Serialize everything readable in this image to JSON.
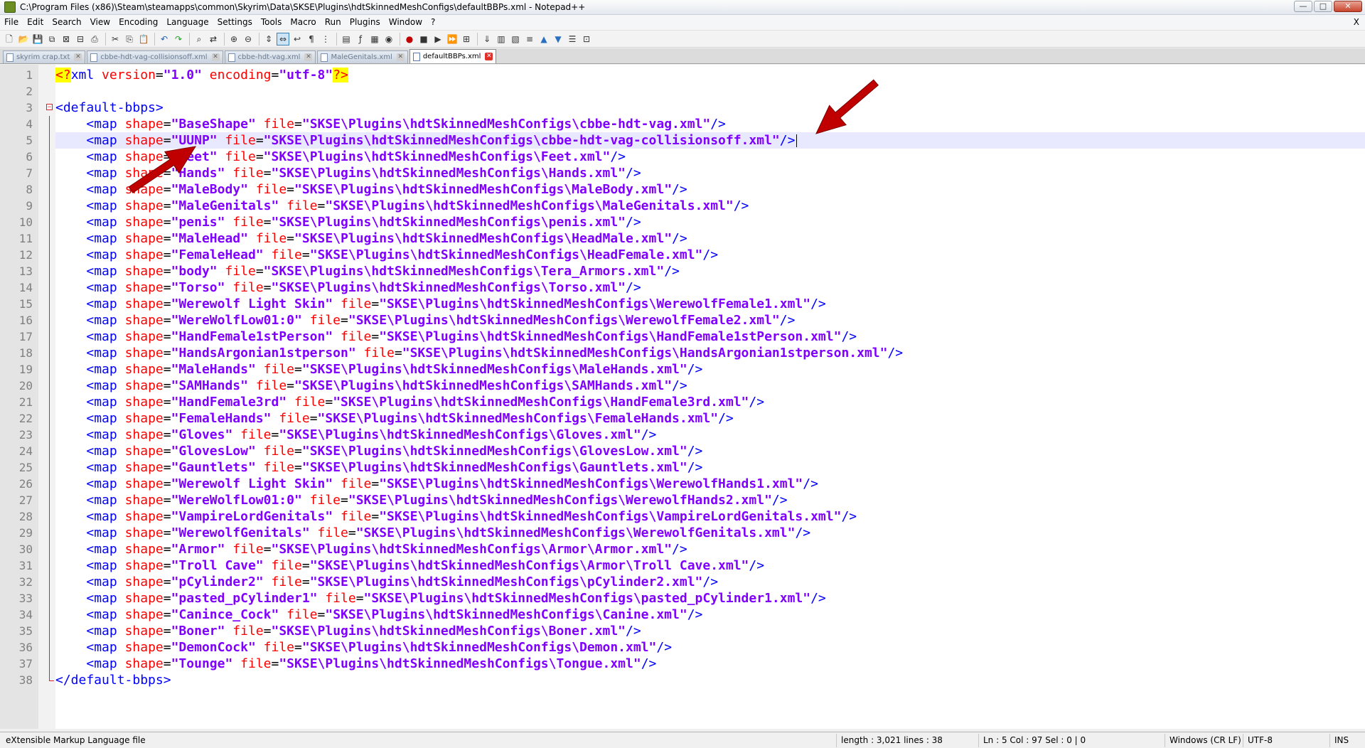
{
  "window": {
    "title": "C:\\Program Files (x86)\\Steam\\steamapps\\common\\Skyrim\\Data\\SKSE\\Plugins\\hdtSkinnedMeshConfigs\\defaultBBPs.xml - Notepad++",
    "icon": "notepad-plus-plus-icon",
    "controls": [
      "minimize-icon",
      "maximize-icon",
      "close-icon"
    ]
  },
  "menu": {
    "items": [
      "File",
      "Edit",
      "Search",
      "View",
      "Encoding",
      "Language",
      "Settings",
      "Tools",
      "Macro",
      "Run",
      "Plugins",
      "Window",
      "?"
    ],
    "close_glyph": "X"
  },
  "toolbar": {
    "icons": [
      "new-file-icon",
      "open-file-icon",
      "save-icon",
      "save-all-icon",
      "close-icon",
      "close-all-icon",
      "print-icon",
      "|",
      "cut-icon",
      "copy-icon",
      "paste-icon",
      "|",
      "undo-icon",
      "redo-icon",
      "|",
      "find-icon",
      "replace-icon",
      "|",
      "zoom-in-icon",
      "zoom-out-icon",
      "|",
      "sync-vertical-icon",
      "sync-horizontal-icon",
      "word-wrap-icon",
      "show-all-chars-icon",
      "indent-guide-icon",
      "|",
      "document-map-icon",
      "function-list-icon",
      "folder-workspace-icon",
      "monitor-icon",
      "|",
      "record-macro-icon",
      "stop-record-icon",
      "play-macro-icon",
      "run-macro-multiple-icon",
      "save-macro-icon",
      "|",
      "plugin-a-icon",
      "plugin-b-icon",
      "plugin-c-icon",
      "plugin-d-icon",
      "plugin-e-icon",
      "plugin-f-icon",
      "plugin-g-icon",
      "plugin-h-icon"
    ],
    "active_index": 22
  },
  "tabs": [
    {
      "label": "skyrim crap.txt",
      "active": false
    },
    {
      "label": "cbbe-hdt-vag-collisionsoff.xml",
      "active": false
    },
    {
      "label": "cbbe-hdt-vag.xml",
      "active": false
    },
    {
      "label": "MaleGenitals.xml",
      "active": false
    },
    {
      "label": "defaultBBPs.xml",
      "active": true
    }
  ],
  "editor": {
    "current_line": 5,
    "colors": {
      "tag": "#0000ff",
      "attr": "#ff0000",
      "value": "#8000ff",
      "pi_bg": "#ffff00",
      "current_line": "#e8e8ff"
    },
    "lines": [
      {
        "n": "1",
        "tokens": [
          [
            "pi",
            "<?"
          ],
          [
            "tag",
            "xml"
          ],
          [
            "plain",
            " "
          ],
          [
            "attr",
            "version"
          ],
          [
            "eq",
            "="
          ],
          [
            "val",
            "\"1.0\""
          ],
          [
            "plain",
            " "
          ],
          [
            "attr",
            "encoding"
          ],
          [
            "eq",
            "="
          ],
          [
            "val",
            "\"utf-8\""
          ],
          [
            "pi",
            "?>"
          ]
        ]
      },
      {
        "n": "2",
        "tokens": []
      },
      {
        "n": "3",
        "tokens": [
          [
            "tag",
            "<default-bbps>"
          ]
        ]
      },
      {
        "n": "4",
        "shape": "BaseShape",
        "file": "SKSE\\Plugins\\hdtSkinnedMeshConfigs\\cbbe-hdt-vag.xml"
      },
      {
        "n": "5",
        "shape": "UUNP",
        "file": "SKSE\\Plugins\\hdtSkinnedMeshConfigs\\cbbe-hdt-vag-collisionsoff.xml"
      },
      {
        "n": "6",
        "shape": "Feet",
        "file": "SKSE\\Plugins\\hdtSkinnedMeshConfigs\\Feet.xml"
      },
      {
        "n": "7",
        "shape": "Hands",
        "file": "SKSE\\Plugins\\hdtSkinnedMeshConfigs\\Hands.xml"
      },
      {
        "n": "8",
        "shape": "MaleBody",
        "file": "SKSE\\Plugins\\hdtSkinnedMeshConfigs\\MaleBody.xml"
      },
      {
        "n": "9",
        "shape": "MaleGenitals",
        "file": "SKSE\\Plugins\\hdtSkinnedMeshConfigs\\MaleGenitals.xml"
      },
      {
        "n": "10",
        "shape": "penis",
        "file": "SKSE\\Plugins\\hdtSkinnedMeshConfigs\\penis.xml"
      },
      {
        "n": "11",
        "shape": "MaleHead",
        "file": "SKSE\\Plugins\\hdtSkinnedMeshConfigs\\HeadMale.xml"
      },
      {
        "n": "12",
        "shape": "FemaleHead",
        "file": "SKSE\\Plugins\\hdtSkinnedMeshConfigs\\HeadFemale.xml"
      },
      {
        "n": "13",
        "shape": "body",
        "file": "SKSE\\Plugins\\hdtSkinnedMeshConfigs\\Tera_Armors.xml"
      },
      {
        "n": "14",
        "shape": "Torso",
        "file": "SKSE\\Plugins\\hdtSkinnedMeshConfigs\\Torso.xml"
      },
      {
        "n": "15",
        "shape": "Werewolf Light Skin",
        "file": "SKSE\\Plugins\\hdtSkinnedMeshConfigs\\WerewolfFemale1.xml"
      },
      {
        "n": "16",
        "shape": "WereWolfLow01:0",
        "file": "SKSE\\Plugins\\hdtSkinnedMeshConfigs\\WerewolfFemale2.xml"
      },
      {
        "n": "17",
        "shape": "HandFemale1stPerson",
        "file": "SKSE\\Plugins\\hdtSkinnedMeshConfigs\\HandFemale1stPerson.xml"
      },
      {
        "n": "18",
        "shape": "HandsArgonian1stperson",
        "file": "SKSE\\Plugins\\hdtSkinnedMeshConfigs\\HandsArgonian1stperson.xml"
      },
      {
        "n": "19",
        "shape": "MaleHands",
        "file": "SKSE\\Plugins\\hdtSkinnedMeshConfigs\\MaleHands.xml"
      },
      {
        "n": "20",
        "shape": "SAMHands",
        "file": "SKSE\\Plugins\\hdtSkinnedMeshConfigs\\SAMHands.xml"
      },
      {
        "n": "21",
        "shape": "HandFemale3rd",
        "file": "SKSE\\Plugins\\hdtSkinnedMeshConfigs\\HandFemale3rd.xml"
      },
      {
        "n": "22",
        "shape": "FemaleHands",
        "file": "SKSE\\Plugins\\hdtSkinnedMeshConfigs\\FemaleHands.xml"
      },
      {
        "n": "23",
        "shape": "Gloves",
        "file": "SKSE\\Plugins\\hdtSkinnedMeshConfigs\\Gloves.xml"
      },
      {
        "n": "24",
        "shape": "GlovesLow",
        "file": "SKSE\\Plugins\\hdtSkinnedMeshConfigs\\GlovesLow.xml"
      },
      {
        "n": "25",
        "shape": "Gauntlets",
        "file": "SKSE\\Plugins\\hdtSkinnedMeshConfigs\\Gauntlets.xml"
      },
      {
        "n": "26",
        "shape": "Werewolf Light Skin",
        "file": "SKSE\\Plugins\\hdtSkinnedMeshConfigs\\WerewolfHands1.xml"
      },
      {
        "n": "27",
        "shape": "WereWolfLow01:0",
        "file": "SKSE\\Plugins\\hdtSkinnedMeshConfigs\\WerewolfHands2.xml"
      },
      {
        "n": "28",
        "shape": "VampireLordGenitals",
        "file": "SKSE\\Plugins\\hdtSkinnedMeshConfigs\\VampireLordGenitals.xml"
      },
      {
        "n": "29",
        "shape": "WerewolfGenitals",
        "file": "SKSE\\Plugins\\hdtSkinnedMeshConfigs\\WerewolfGenitals.xml"
      },
      {
        "n": "30",
        "shape": "Armor",
        "file": "SKSE\\Plugins\\hdtSkinnedMeshConfigs\\Armor\\Armor.xml"
      },
      {
        "n": "31",
        "shape": "Troll Cave",
        "file": "SKSE\\Plugins\\hdtSkinnedMeshConfigs\\Armor\\Troll Cave.xml"
      },
      {
        "n": "32",
        "shape": "pCylinder2",
        "file": "SKSE\\Plugins\\hdtSkinnedMeshConfigs\\pCylinder2.xml"
      },
      {
        "n": "33",
        "shape": "pasted_pCylinder1",
        "file": "SKSE\\Plugins\\hdtSkinnedMeshConfigs\\pasted_pCylinder1.xml"
      },
      {
        "n": "34",
        "shape": "Canince_Cock",
        "file": "SKSE\\Plugins\\hdtSkinnedMeshConfigs\\Canine.xml"
      },
      {
        "n": "35",
        "shape": "Boner",
        "file": "SKSE\\Plugins\\hdtSkinnedMeshConfigs\\Boner.xml"
      },
      {
        "n": "36",
        "shape": "DemonCock",
        "file": "SKSE\\Plugins\\hdtSkinnedMeshConfigs\\Demon.xml"
      },
      {
        "n": "37",
        "shape": "Tounge",
        "file": "SKSE\\Plugins\\hdtSkinnedMeshConfigs\\Tongue.xml"
      },
      {
        "n": "38",
        "tokens": [
          [
            "tag",
            "</default-bbps>"
          ]
        ]
      }
    ]
  },
  "status": {
    "file_type": "eXtensible Markup Language file",
    "length_lines": "length : 3,021    lines : 38",
    "position": "Ln : 5    Col : 97    Sel : 0 | 0",
    "eol": "Windows (CR LF)",
    "encoding": "UTF-8",
    "mode": "INS"
  },
  "annotation_color": "#c00000"
}
